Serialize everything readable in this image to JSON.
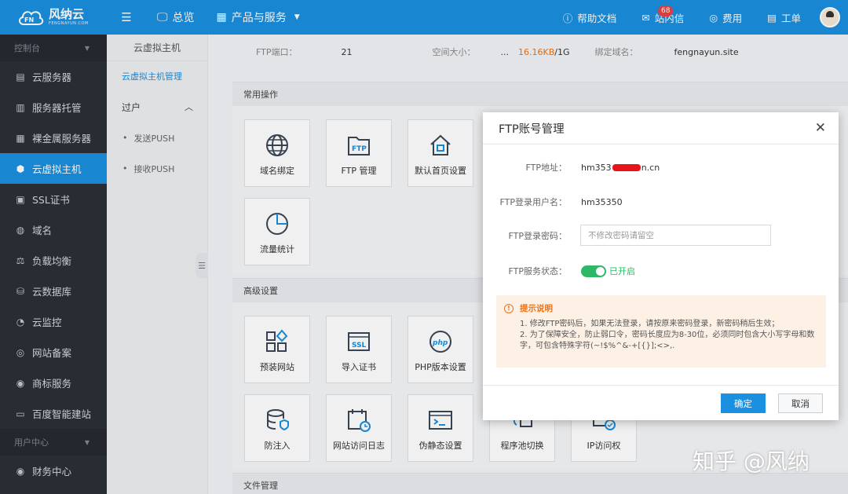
{
  "topbar": {
    "logo_name": "风纳云",
    "logo_sub": "FENGNAYUN.COM",
    "nav": [
      "总览",
      "产品与服务"
    ],
    "right": [
      {
        "label": "帮助文档",
        "icon": "question-icon"
      },
      {
        "label": "站内信",
        "icon": "mail-icon",
        "badge": "68"
      },
      {
        "label": "费用",
        "icon": "coin-icon"
      },
      {
        "label": "工单",
        "icon": "ticket-icon"
      }
    ]
  },
  "sidebar": {
    "head1": "控制台",
    "items": [
      {
        "label": "云服务器",
        "icon": "server-icon"
      },
      {
        "label": "服务器托管",
        "icon": "hosting-icon"
      },
      {
        "label": "裸金属服务器",
        "icon": "bare-metal-icon"
      },
      {
        "label": "云虚拟主机",
        "icon": "cube-icon",
        "active": true
      },
      {
        "label": "SSL证书",
        "icon": "ssl-icon"
      },
      {
        "label": "域名",
        "icon": "globe-icon"
      },
      {
        "label": "负载均衡",
        "icon": "balance-icon"
      },
      {
        "label": "云数据库",
        "icon": "database-icon"
      },
      {
        "label": "云监控",
        "icon": "monitor-icon"
      },
      {
        "label": "网站备案",
        "icon": "record-icon"
      },
      {
        "label": "商标服务",
        "icon": "trademark-icon"
      },
      {
        "label": "百度智能建站",
        "icon": "site-builder-icon"
      }
    ],
    "head2": "用户中心",
    "items2": [
      {
        "label": "财务中心",
        "icon": "finance-icon"
      }
    ]
  },
  "subside": {
    "title": "云虚拟主机",
    "active": "云虚拟主机管理",
    "group": "过户",
    "items": [
      "发送PUSH",
      "接收PUSH"
    ]
  },
  "info": {
    "port_label": "FTP端口：",
    "port": "21",
    "space_label": "空间大小：",
    "space_prefix": "...",
    "space_used": "16.16KB",
    "space_total": "/1G",
    "domain_label": "绑定域名：",
    "domain": "fengnayun.site"
  },
  "panels": {
    "common": "常用操作",
    "advanced": "高级设置",
    "files": "文件管理",
    "common_tiles": [
      "域名绑定",
      "FTP 管理",
      "默认首页设置",
      "流量统计"
    ],
    "advanced_tiles": [
      "预装网站",
      "导入证书",
      "PHP版本设置",
      "防注入",
      "网站访问日志",
      "伪静态设置",
      "程序池切换",
      "IP访问权"
    ]
  },
  "modal": {
    "title": "FTP账号管理",
    "ftp_addr_label": "FTP地址：",
    "ftp_addr_prefix": "hm353",
    "ftp_addr_suffix": "n.cn",
    "user_label": "FTP登录用户名：",
    "user": "hm35350",
    "pw_label": "FTP登录密码：",
    "pw_placeholder": "不修改密码请留空",
    "status_label": "FTP服务状态：",
    "status_text": "已开启",
    "tip_title": "提示说明",
    "tip_lines": [
      "1. 修改FTP密码后，如果无法登录，请按原来密码登录，新密码稍后生效；",
      "2. 为了保障安全，防止弱口令，密码长度应为8-30位，必须同时包含大小写字母和数",
      "字，可包含特殊字符(~!$%^&-+[{}];<>,."
    ],
    "ok": "确定",
    "cancel": "取消"
  },
  "watermark": "知乎 @风纳",
  "colors": {
    "primary": "#1b8fe0",
    "sidebar": "#2b3037",
    "orange": "#e8741a",
    "green": "#2cb866"
  }
}
